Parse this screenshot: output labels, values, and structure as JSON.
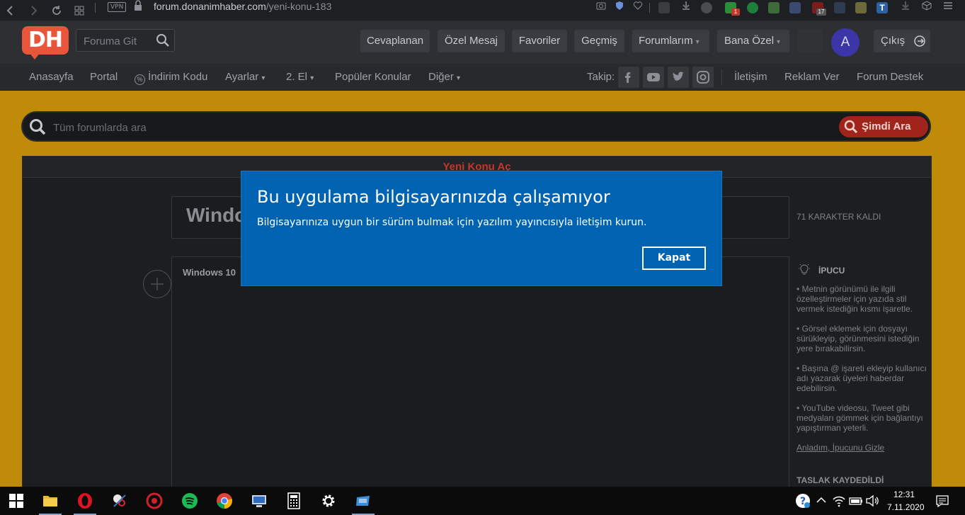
{
  "browser": {
    "vpn": "VPN",
    "url_domain": "forum.donanimhaber.com",
    "url_path": "/yeni-konu-183",
    "badges": [
      "1",
      "17"
    ]
  },
  "header": {
    "logo": "DH",
    "goto_placeholder": "Foruma Git",
    "buttons": [
      "Cevaplanan",
      "Özel Mesaj",
      "Favoriler",
      "Geçmiş",
      "Forumlarım",
      "Bana Özel"
    ],
    "avatar_letter": "A",
    "logout": "Çıkış"
  },
  "nav": {
    "items": [
      "Anasayfa",
      "Portal",
      "İndirim Kodu",
      "Ayarlar",
      "2. El",
      "Popüler Konular",
      "Diğer"
    ],
    "follow_label": "Takip:",
    "right_items": [
      "İletişim",
      "Reklam Ver",
      "Forum Destek"
    ]
  },
  "search": {
    "placeholder": "Tüm forumlarda ara",
    "button": "Şimdi Ara"
  },
  "panel": {
    "title": "Yeni Konu Aç",
    "title_input_partial": "Windo",
    "chars_left": "71 KARAKTER KALDI",
    "editor_partial": "Windows 10",
    "tips_heading": "İPUCU",
    "tips": [
      "• Metnin görünümü ile ilgili özelleştirmeler için yazıda stil vermek istediğin kısmı işaretle.",
      "• Görsel eklemek için dosyayı sürükleyip, görünmesini istediğin yere bırakabilirsin.",
      "• Başına @ işareti ekleyip kullanıcı adı yazarak üyeleri haberdar edebilirsin.",
      "• YouTube videosu, Tweet gibi medyaları gömmek için bağlantıyı yapıştırman yeterli."
    ],
    "tips_hide": "Anladım, İpucunu Gizle",
    "draft": "TASLAK KAYDEDİLDİ"
  },
  "dialog": {
    "title": "Bu uygulama bilgisayarınızda çalışamıyor",
    "message": "Bilgisayarınıza uygun bir sürüm bulmak için yazılım yayıncısıyla iletişim kurun.",
    "close": "Kapat"
  },
  "taskbar": {
    "time": "12:31",
    "date": "7.11.2020"
  },
  "colors": {
    "dialog_bg": "#0063b1",
    "accent_gold": "#bf8b08",
    "brand_red": "#e8553b"
  }
}
